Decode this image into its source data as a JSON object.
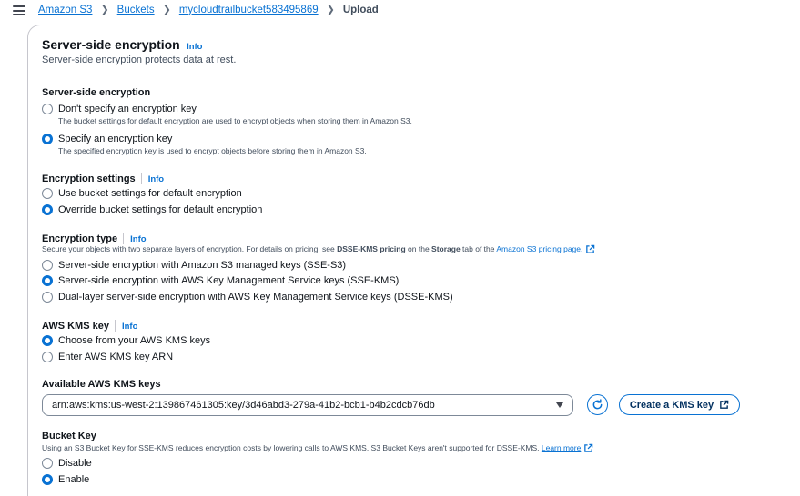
{
  "breadcrumbs": [
    "Amazon S3",
    "Buckets",
    "mycloudtrailbucket583495869"
  ],
  "breadcrumb_current": "Upload",
  "section": {
    "title": "Server-side encryption",
    "info": "Info",
    "description": "Server-side encryption protects data at rest."
  },
  "sse": {
    "label": "Server-side encryption",
    "options": [
      {
        "label": "Don't specify an encryption key",
        "desc": "The bucket settings for default encryption are used to encrypt objects when storing them in Amazon S3.",
        "checked": false
      },
      {
        "label": "Specify an encryption key",
        "desc": "The specified encryption key is used to encrypt objects before storing them in Amazon S3.",
        "checked": true
      }
    ]
  },
  "enc_settings": {
    "label": "Encryption settings",
    "info": "Info",
    "options": [
      {
        "label": "Use bucket settings for default encryption",
        "checked": false
      },
      {
        "label": "Override bucket settings for default encryption",
        "checked": true
      }
    ]
  },
  "enc_type": {
    "label": "Encryption type",
    "info": "Info",
    "desc_prefix": "Secure your objects with two separate layers of encryption. For details on pricing, see ",
    "desc_bold1": "DSSE-KMS pricing",
    "desc_mid": " on the ",
    "desc_bold2": "Storage",
    "desc_suffix": " tab of the ",
    "desc_link": "Amazon S3 pricing page.",
    "options": [
      {
        "label": "Server-side encryption with Amazon S3 managed keys (SSE-S3)",
        "checked": false
      },
      {
        "label": "Server-side encryption with AWS Key Management Service keys (SSE-KMS)",
        "checked": true
      },
      {
        "label": "Dual-layer server-side encryption with AWS Key Management Service keys (DSSE-KMS)",
        "checked": false
      }
    ]
  },
  "kms_key": {
    "label": "AWS KMS key",
    "info": "Info",
    "options": [
      {
        "label": "Choose from your AWS KMS keys",
        "checked": true
      },
      {
        "label": "Enter AWS KMS key ARN",
        "checked": false
      }
    ]
  },
  "available_keys": {
    "label": "Available AWS KMS keys",
    "selected": "arn:aws:kms:us-west-2:139867461305:key/3d46abd3-279a-41b2-bcb1-b4b2cdcb76db",
    "create_button": "Create a KMS key"
  },
  "bucket_key": {
    "label": "Bucket Key",
    "desc": "Using an S3 Bucket Key for SSE-KMS reduces encryption costs by lowering calls to AWS KMS. S3 Bucket Keys aren't supported for DSSE-KMS.",
    "learn_more": "Learn more",
    "options": [
      {
        "label": "Disable",
        "checked": false
      },
      {
        "label": "Enable",
        "checked": true
      }
    ]
  },
  "icons": {
    "menu": "hamburger-menu-icon",
    "breadcrumb_separator": "chevron-right-icon",
    "refresh": "refresh-icon",
    "external": "external-link-icon",
    "dropdown": "caret-down-icon"
  },
  "colors": {
    "accent": "#0972d3",
    "text": "#0f141a",
    "secondary_text": "#414d5c",
    "border": "#c6c6cd"
  }
}
